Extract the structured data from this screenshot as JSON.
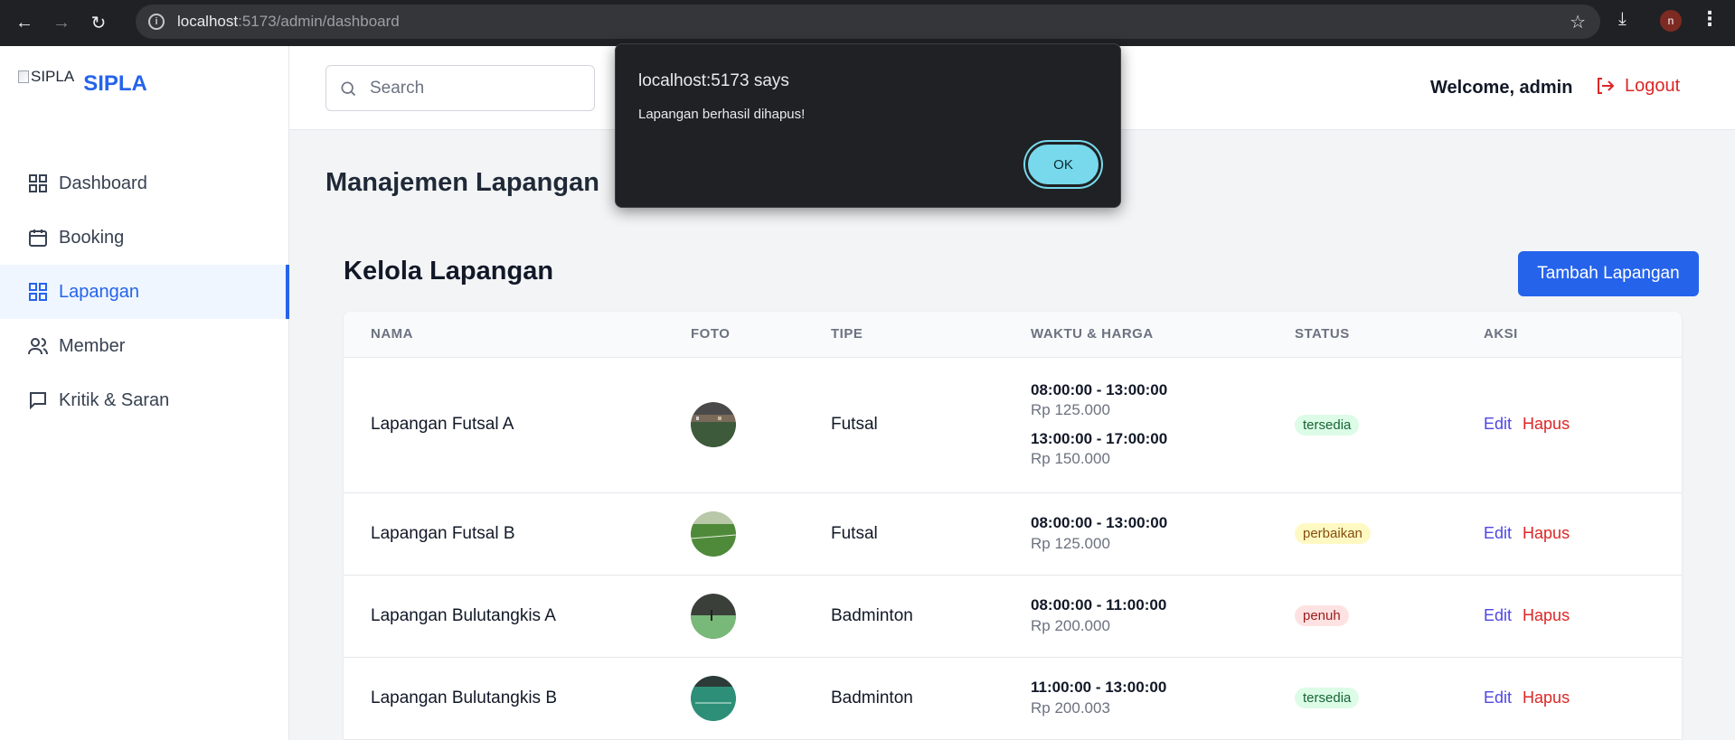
{
  "browser": {
    "url_host": "localhost",
    "url_path": ":5173/admin/dashboard",
    "profile_initial": "n"
  },
  "sidebar": {
    "logo_alt": "SIPLA",
    "brand": "SIPLA",
    "items": [
      {
        "label": "Dashboard",
        "icon": "grid-icon",
        "active": false
      },
      {
        "label": "Booking",
        "icon": "calendar-icon",
        "active": false
      },
      {
        "label": "Lapangan",
        "icon": "grid-icon",
        "active": true
      },
      {
        "label": "Member",
        "icon": "users-icon",
        "active": false
      },
      {
        "label": "Kritik & Saran",
        "icon": "chat-icon",
        "active": false
      }
    ]
  },
  "header": {
    "search_placeholder": "Search",
    "welcome": "Welcome, admin",
    "logout": "Logout"
  },
  "main": {
    "page_title": "Manajemen Lapangan",
    "card_title": "Kelola Lapangan",
    "add_button": "Tambah Lapangan",
    "columns": [
      "NAMA",
      "FOTO",
      "TIPE",
      "WAKTU & HARGA",
      "STATUS",
      "AKSI"
    ],
    "rows": [
      {
        "nama": "Lapangan Futsal A",
        "tipe": "Futsal",
        "slots": [
          {
            "time": "08:00:00 - 13:00:00",
            "price": "Rp 125.000"
          },
          {
            "time": "13:00:00 - 17:00:00",
            "price": "Rp 150.000"
          }
        ],
        "status": "tersedia",
        "edit": "Edit",
        "hapus": "Hapus"
      },
      {
        "nama": "Lapangan Futsal B",
        "tipe": "Futsal",
        "slots": [
          {
            "time": "08:00:00 - 13:00:00",
            "price": "Rp 125.000"
          }
        ],
        "status": "perbaikan",
        "edit": "Edit",
        "hapus": "Hapus"
      },
      {
        "nama": "Lapangan Bulutangkis A",
        "tipe": "Badminton",
        "slots": [
          {
            "time": "08:00:00 - 11:00:00",
            "price": "Rp 200.000"
          }
        ],
        "status": "penuh",
        "edit": "Edit",
        "hapus": "Hapus"
      },
      {
        "nama": "Lapangan Bulutangkis B",
        "tipe": "Badminton",
        "slots": [
          {
            "time": "11:00:00 - 13:00:00",
            "price": "Rp 200.003"
          }
        ],
        "status": "tersedia",
        "edit": "Edit",
        "hapus": "Hapus"
      }
    ]
  },
  "dialog": {
    "title": "localhost:5173 says",
    "message": "Lapangan berhasil dihapus!",
    "ok": "OK"
  },
  "colors": {
    "accent": "#2563eb",
    "danger": "#dc2626",
    "status_tersedia_bg": "#dcfce7",
    "status_tersedia_fg": "#166534",
    "status_perbaikan_bg": "#fef9c3",
    "status_perbaikan_fg": "#854d0e",
    "status_penuh_bg": "#fee2e2",
    "status_penuh_fg": "#991b1b"
  }
}
